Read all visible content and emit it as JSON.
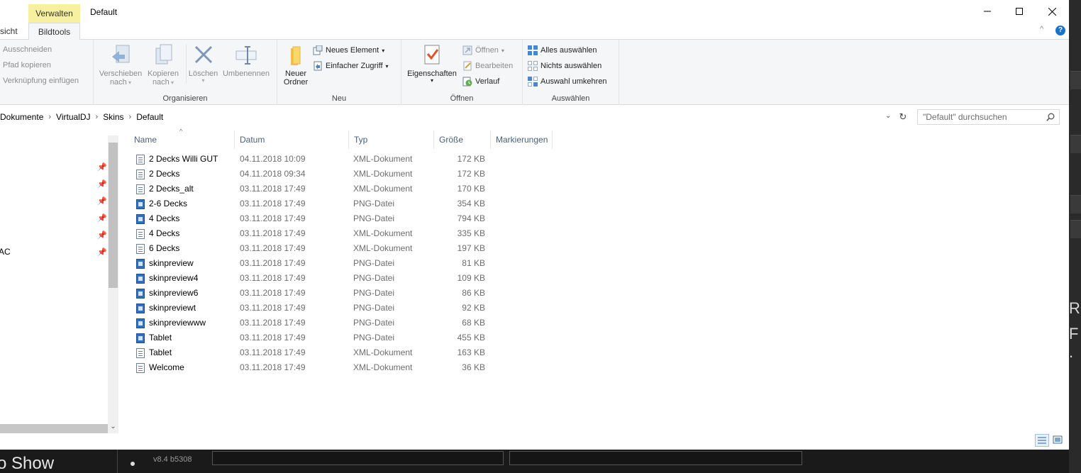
{
  "window": {
    "title": "Default",
    "context_tab": "Verwalten",
    "context_subtab": "Bildtools",
    "partial_tab": "sicht",
    "help": "?"
  },
  "ribbon": {
    "clipboard": {
      "cut": "Ausschneiden",
      "copy_path": "Pfad kopieren",
      "paste_shortcut": "Verknüpfung einfügen"
    },
    "organize": {
      "label": "Organisieren",
      "move_to_1": "Verschieben",
      "move_to_2": "nach",
      "copy_to_1": "Kopieren",
      "copy_to_2": "nach",
      "delete": "Löschen",
      "rename": "Umbenennen"
    },
    "new": {
      "label": "Neu",
      "new_folder_1": "Neuer",
      "new_folder_2": "Ordner",
      "new_item": "Neues Element",
      "easy_access": "Einfacher Zugriff"
    },
    "open": {
      "label": "Öffnen",
      "properties": "Eigenschaften",
      "open": "Öffnen",
      "edit": "Bearbeiten",
      "history": "Verlauf"
    },
    "select": {
      "label": "Auswählen",
      "select_all": "Alles auswählen",
      "select_none": "Nichts auswählen",
      "invert": "Auswahl umkehren"
    }
  },
  "address": {
    "crumbs": [
      "Dokumente",
      "VirtualDJ",
      "Skins",
      "Default"
    ],
    "search_placeholder": "\"Default\" durchsuchen"
  },
  "nav": {
    "partial_item": "AC"
  },
  "columns": {
    "name": "Name",
    "date": "Datum",
    "type": "Typ",
    "size": "Größe",
    "tags": "Markierungen"
  },
  "files": [
    {
      "name": "2 Decks Willi GUT",
      "date": "04.11.2018 10:09",
      "type": "XML-Dokument",
      "size": "172 KB",
      "icon": "xml"
    },
    {
      "name": "2 Decks",
      "date": "04.11.2018 09:34",
      "type": "XML-Dokument",
      "size": "172 KB",
      "icon": "xml"
    },
    {
      "name": "2 Decks_alt",
      "date": "03.11.2018 17:49",
      "type": "XML-Dokument",
      "size": "170 KB",
      "icon": "xml"
    },
    {
      "name": "2-6 Decks",
      "date": "03.11.2018 17:49",
      "type": "PNG-Datei",
      "size": "354 KB",
      "icon": "png"
    },
    {
      "name": "4 Decks",
      "date": "03.11.2018 17:49",
      "type": "PNG-Datei",
      "size": "794 KB",
      "icon": "png"
    },
    {
      "name": "4 Decks",
      "date": "03.11.2018 17:49",
      "type": "XML-Dokument",
      "size": "335 KB",
      "icon": "xml"
    },
    {
      "name": "6 Decks",
      "date": "03.11.2018 17:49",
      "type": "XML-Dokument",
      "size": "197 KB",
      "icon": "xml"
    },
    {
      "name": "skinpreview",
      "date": "03.11.2018 17:49",
      "type": "PNG-Datei",
      "size": "81 KB",
      "icon": "png"
    },
    {
      "name": "skinpreview4",
      "date": "03.11.2018 17:49",
      "type": "PNG-Datei",
      "size": "109 KB",
      "icon": "png"
    },
    {
      "name": "skinpreview6",
      "date": "03.11.2018 17:49",
      "type": "PNG-Datei",
      "size": "86 KB",
      "icon": "png"
    },
    {
      "name": "skinpreviewt",
      "date": "03.11.2018 17:49",
      "type": "PNG-Datei",
      "size": "92 KB",
      "icon": "png"
    },
    {
      "name": "skinpreviewww",
      "date": "03.11.2018 17:49",
      "type": "PNG-Datei",
      "size": "68 KB",
      "icon": "png"
    },
    {
      "name": "Tablet",
      "date": "03.11.2018 17:49",
      "type": "PNG-Datei",
      "size": "455 KB",
      "icon": "png"
    },
    {
      "name": "Tablet",
      "date": "03.11.2018 17:49",
      "type": "XML-Dokument",
      "size": "163 KB",
      "icon": "xml"
    },
    {
      "name": "Welcome",
      "date": "03.11.2018 17:49",
      "type": "XML-Dokument",
      "size": "36 KB",
      "icon": "xml"
    }
  ],
  "background_app": {
    "show_text": "o Show",
    "version": "v8.4 b5308",
    "right_text_1": "RO",
    "right_text_2": "F ."
  }
}
